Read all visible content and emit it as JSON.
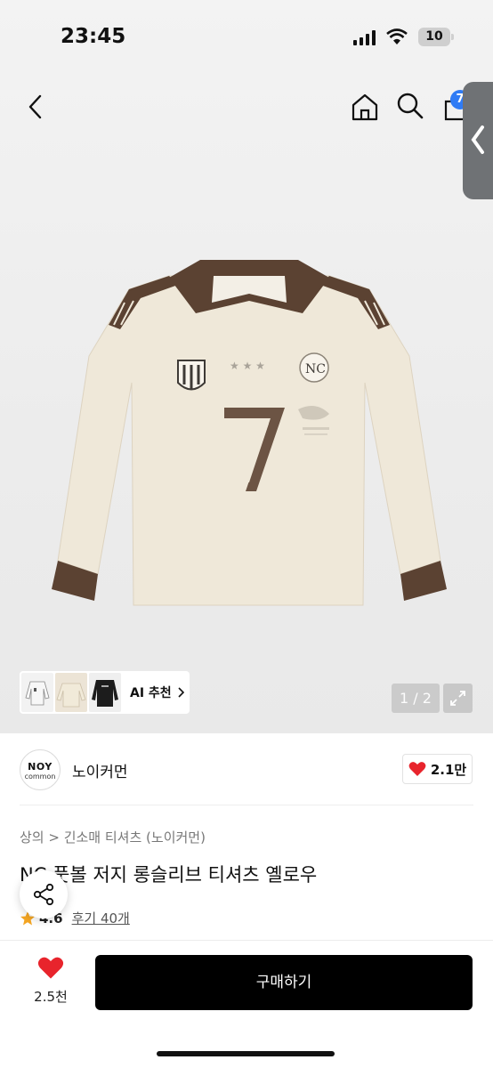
{
  "status_bar": {
    "time": "23:45",
    "battery": "10"
  },
  "nav": {
    "cart_count": "7"
  },
  "gallery": {
    "pager": "1 / 2",
    "ai_recommend": "AI 추천"
  },
  "brand": {
    "logo_top": "NOY",
    "logo_bottom": "common",
    "name": "노이커먼",
    "likes": "2.1만"
  },
  "breadcrumb": "상의 > 긴소매 티셔츠 (노이커먼)",
  "product": {
    "name": "NC 풋볼 저지 롱슬리브 티셔츠 옐로우",
    "rating": "4.6",
    "reviews": "후기 40개"
  },
  "bottom": {
    "wish_count": "2.5천",
    "buy_label": "구매하기"
  },
  "colors": {
    "accent": "#2f7bf5",
    "heart": "#e8242c",
    "buy_button": "#000000",
    "shirt": "#efe8d9",
    "trim": "#5b4232"
  }
}
